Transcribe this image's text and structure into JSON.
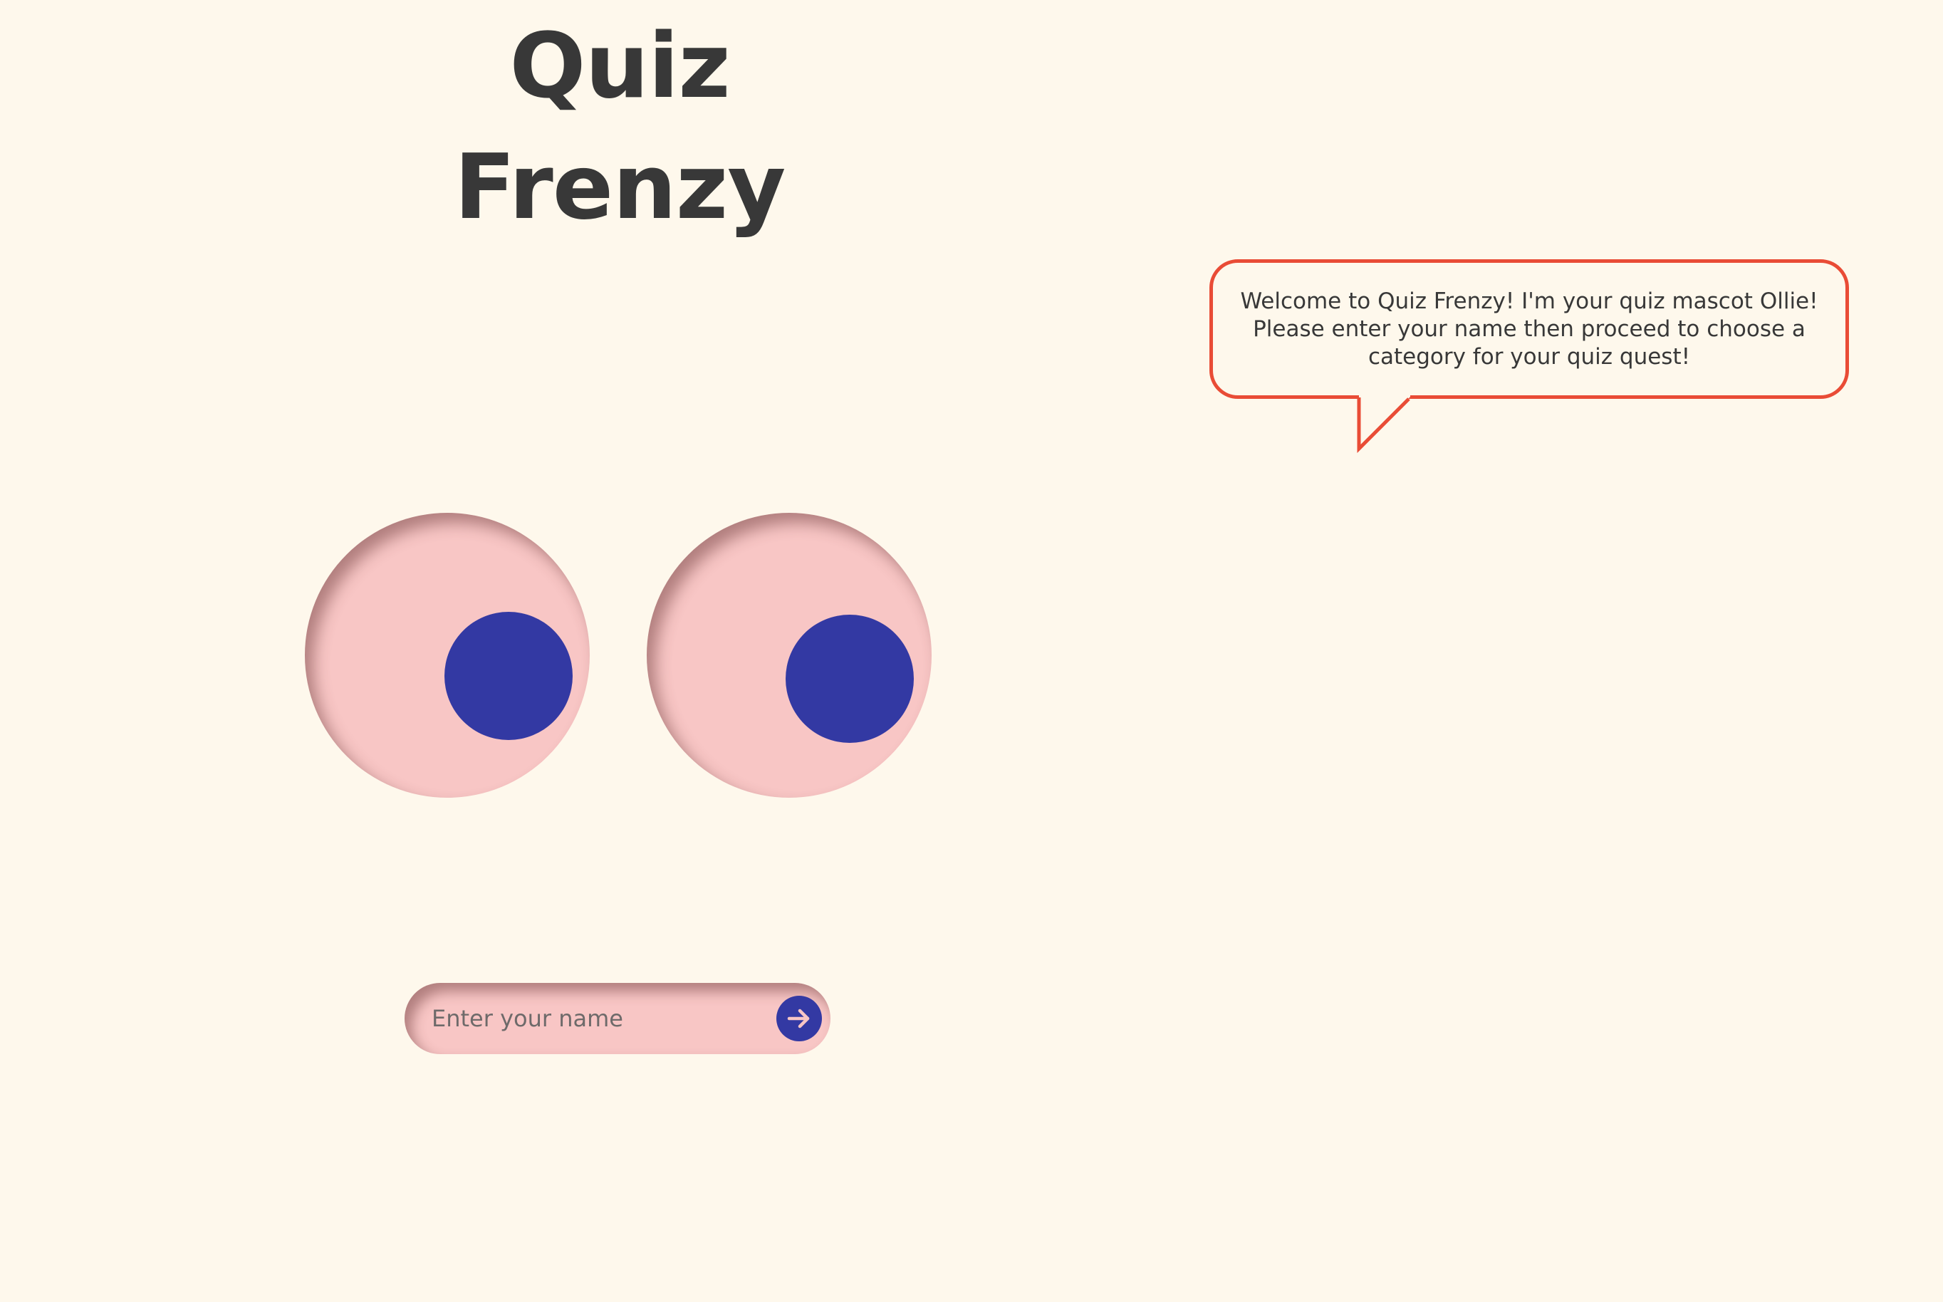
{
  "app": {
    "title": "Quiz Frenzy"
  },
  "mascot": {
    "speech": "Welcome to Quiz Frenzy! I'm your quiz mascot Ollie! Please enter your name then proceed to choose a category for your quiz quest!"
  },
  "name_form": {
    "input_value": "",
    "placeholder": "Enter your name",
    "submit_icon": "arrow-right-icon"
  },
  "colors": {
    "background": "#fef8ec",
    "eye": "#f8c6c5",
    "pupil": "#3339a3",
    "bubble_border": "#e94c36",
    "text": "#383838"
  }
}
